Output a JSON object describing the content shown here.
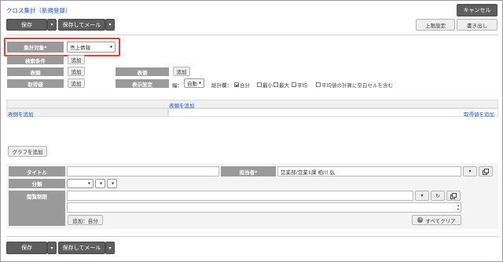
{
  "page": {
    "title": "クロス集計（新規登録）"
  },
  "toolbar": {
    "save": "保存",
    "save_mail": "保存してメール",
    "cancel": "キャンセル",
    "limit": "上限設定",
    "export": "書き出し"
  },
  "settings": {
    "target_label": "集計対象*",
    "target_value": "売上情報",
    "search_label": "検索条件",
    "head_label": "表頭",
    "side_label": "表側",
    "value_label": "取得値",
    "display_label": "表示設定",
    "add": "追加",
    "width_label": "幅：",
    "width_value": "自動",
    "total_label": "総計欄：",
    "opt_sum": "合計",
    "opt_min": "最小",
    "opt_max": "最大",
    "opt_avg": "平均",
    "opt_blank": "平均値の計算に空白セルを含む"
  },
  "crosstab": {
    "add_head": "表頭を追加",
    "add_side": "表側を追加",
    "add_value": "取得値を追加"
  },
  "graph": {
    "add": "グラフを追加"
  },
  "info": {
    "title_label": "タイトル",
    "assignee_label": "担当者*",
    "assignee_value": "営業部/営業1課 相川 弘",
    "category_label": "分類",
    "access_label": "閲覧制限",
    "add_self": "追加：自分",
    "clear_all": "すべてクリア"
  },
  "colors": {
    "accent": "#1a55c8",
    "highlight": "#e0422b",
    "dark_button": "#5e5e5e"
  }
}
